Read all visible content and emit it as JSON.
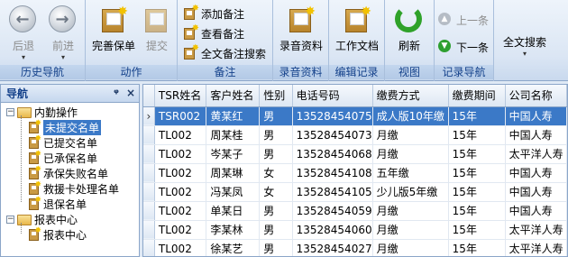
{
  "ribbon": {
    "groups": {
      "history_nav": {
        "label": "历史导航",
        "back": "后退",
        "forward": "前进"
      },
      "actions": {
        "label": "动作",
        "complete_policy": "完善保单",
        "submit": "提交"
      },
      "notes": {
        "label": "备注",
        "add_note": "添加备注",
        "view_note": "查看备注",
        "fulltext_note_search": "全文备注搜索"
      },
      "recording": {
        "label": "录音资料",
        "recording_material": "录音资料"
      },
      "edit_record": {
        "label": "编辑记录",
        "work_doc": "工作文档"
      },
      "view": {
        "label": "视图",
        "refresh": "刷新"
      },
      "record_nav": {
        "label": "记录导航",
        "prev": "上一条",
        "next": "下一条"
      },
      "search": {
        "fulltext_search": "全文搜索"
      }
    }
  },
  "nav": {
    "title": "导航",
    "pin": "ᵠ",
    "close": "×",
    "tree": [
      {
        "label": "内勤操作",
        "level": 0,
        "type": "folder"
      },
      {
        "label": "未提交名单",
        "level": 1,
        "type": "doc",
        "selected": true
      },
      {
        "label": "已提交名单",
        "level": 1,
        "type": "doc"
      },
      {
        "label": "已承保名单",
        "level": 1,
        "type": "doc"
      },
      {
        "label": "承保失败名单",
        "level": 1,
        "type": "doc"
      },
      {
        "label": "救援卡处理名单",
        "level": 1,
        "type": "doc"
      },
      {
        "label": "退保名单",
        "level": 1,
        "type": "doc"
      },
      {
        "label": "报表中心",
        "level": 0,
        "type": "folder"
      },
      {
        "label": "报表中心",
        "level": 1,
        "type": "doc"
      }
    ]
  },
  "grid": {
    "columns": [
      "TSR姓名",
      "客户姓名",
      "性别",
      "电话号码",
      "缴费方式",
      "缴费期间",
      "公司名称"
    ],
    "rows": [
      [
        "TSR002",
        "黄某红",
        "男",
        "13528454075",
        "成人版10年缴",
        "15年",
        "中国人寿"
      ],
      [
        "TL002",
        "周某桂",
        "男",
        "13528454073",
        "月缴",
        "15年",
        "中国人寿"
      ],
      [
        "TL002",
        "岑某子",
        "男",
        "13528454068",
        "月缴",
        "15年",
        "太平洋人寿"
      ],
      [
        "TL002",
        "周某琳",
        "女",
        "13528454108",
        "五年缴",
        "15年",
        "中国人寿"
      ],
      [
        "TL002",
        "冯某凤",
        "女",
        "13528454105",
        "少儿版5年缴",
        "15年",
        "中国人寿"
      ],
      [
        "TL002",
        "单某日",
        "男",
        "13528454059",
        "月缴",
        "15年",
        "中国人寿"
      ],
      [
        "TL002",
        "李某林",
        "男",
        "13528454060",
        "月缴",
        "15年",
        "太平洋人寿"
      ],
      [
        "TL002",
        "徐某艺",
        "男",
        "13528454027",
        "月缴",
        "15年",
        "太平洋人寿"
      ]
    ],
    "selected_row": 0
  },
  "colors": {
    "selection": "#3b79c7",
    "ribbon_label": "#15428b"
  }
}
